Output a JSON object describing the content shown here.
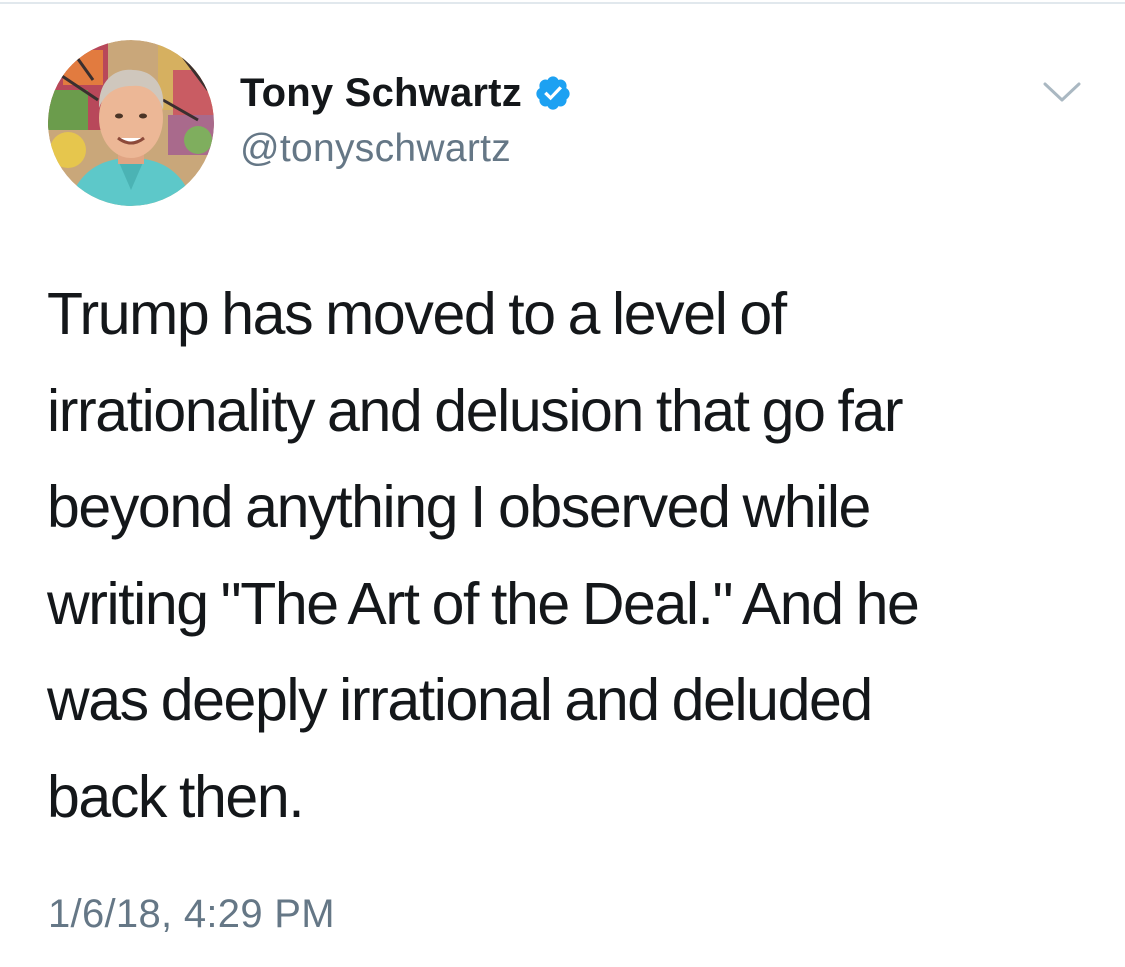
{
  "tweet": {
    "author": {
      "display_name": "Tony Schwartz",
      "handle": "@tonyschwartz",
      "verified": true,
      "verified_icon": "verified-badge-icon",
      "avatar_icon": "profile-photo"
    },
    "text_lines": [
      "Trump has moved to a level of",
      "irrationality and delusion that go far",
      "beyond anything I observed while",
      "writing \"The Art of the Deal.\" And he",
      "was deeply irrational and deluded",
      "back then."
    ],
    "timestamp": "1/6/18, 4:29 PM",
    "menu_icon": "chevron-down-icon"
  },
  "colors": {
    "text_primary": "#14171a",
    "text_secondary": "#657786",
    "verified_blue": "#1da1f2",
    "chevron_gray": "#aab8c2",
    "divider": "#e1e8ed"
  }
}
